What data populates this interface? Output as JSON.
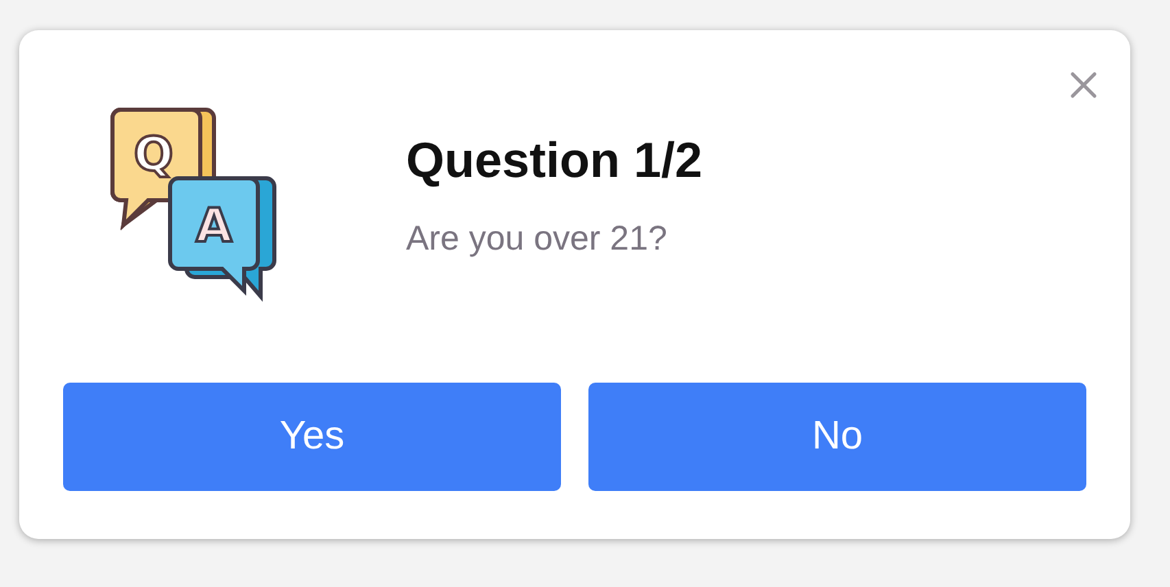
{
  "dialog": {
    "icon_letters": [
      "Q",
      "A"
    ],
    "title": "Question 1/2",
    "question": "Are you over 21?",
    "buttons": [
      {
        "label": "Yes"
      },
      {
        "label": "No"
      }
    ]
  }
}
